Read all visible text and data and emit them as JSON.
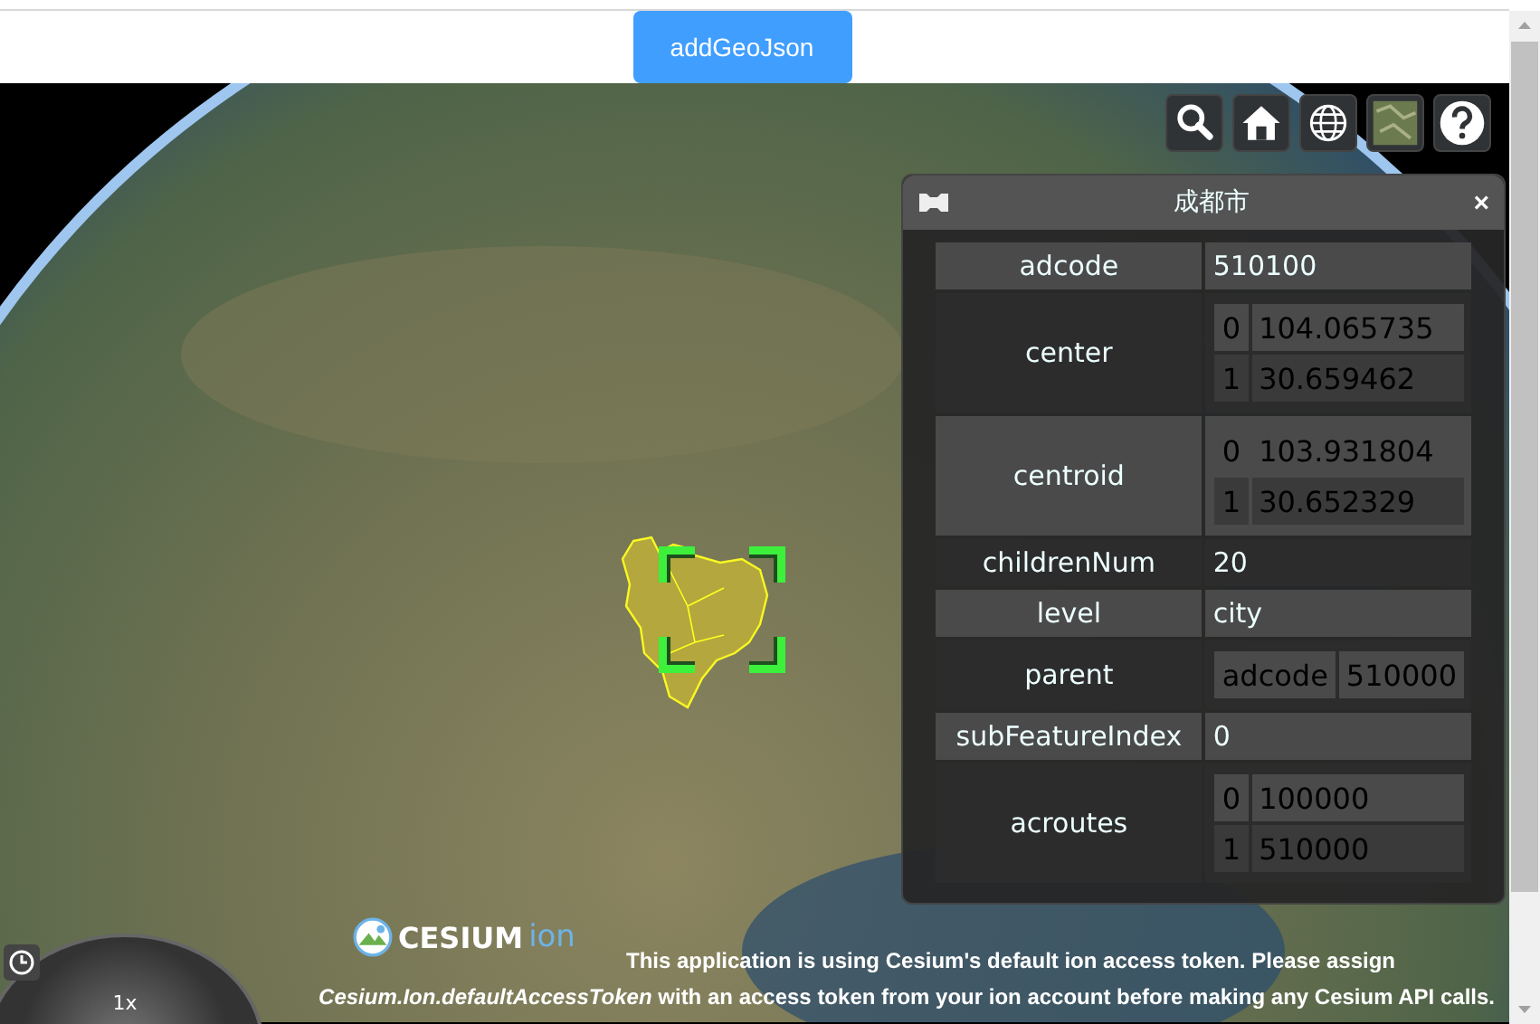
{
  "header": {
    "button": "addGeoJson"
  },
  "toolbar": [
    {
      "kind": "search"
    },
    {
      "kind": "home"
    },
    {
      "kind": "globe"
    },
    {
      "kind": "imagery"
    },
    {
      "kind": "help"
    }
  ],
  "infobox": {
    "title": "成都市",
    "close": "×",
    "rows": [
      {
        "key": "adcode",
        "kind": "text",
        "value": "510100"
      },
      {
        "key": "center",
        "kind": "list",
        "items": [
          {
            "index": "0",
            "value": "104.065735"
          },
          {
            "index": "1",
            "value": "30.659462"
          }
        ]
      },
      {
        "key": "centroid",
        "kind": "list",
        "items": [
          {
            "index": "0",
            "value": "103.931804"
          },
          {
            "index": "1",
            "value": "30.652329"
          }
        ]
      },
      {
        "key": "childrenNum",
        "kind": "text",
        "value": "20"
      },
      {
        "key": "level",
        "kind": "text",
        "value": "city"
      },
      {
        "key": "parent",
        "kind": "list",
        "items": [
          {
            "index": "adcode",
            "value": "510000"
          }
        ]
      },
      {
        "key": "subFeatureIndex",
        "kind": "text",
        "value": "0"
      },
      {
        "key": "acroutes",
        "kind": "list",
        "items": [
          {
            "index": "0",
            "value": "100000"
          },
          {
            "index": "1",
            "value": "510000"
          }
        ]
      }
    ]
  },
  "animation": {
    "speed": "1x"
  },
  "credits": {
    "logo": "CESIUM",
    "logo_suffix": "ion",
    "lines": [
      "This application is using Cesium's default ion access token. Please assign",
      "*Cesium.Ion.defaultAccessToken* with an access token from your ion account before making any Cesium API calls."
    ]
  }
}
